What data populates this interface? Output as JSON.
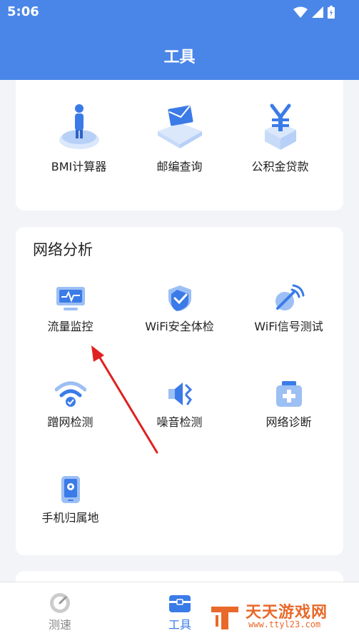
{
  "status_bar": {
    "time": "5:06"
  },
  "app_bar": {
    "title": "工具"
  },
  "top_tools": [
    {
      "label": "BMI计算器",
      "icon": "person-on-scale-icon"
    },
    {
      "label": "邮编查询",
      "icon": "envelope-icon"
    },
    {
      "label": "公积金贷款",
      "icon": "yuan-coin-icon"
    }
  ],
  "network_section": {
    "title": "网络分析",
    "tools": [
      {
        "label": "流量监控",
        "icon": "monitor-icon"
      },
      {
        "label": "WiFi安全体检",
        "icon": "shield-check-icon"
      },
      {
        "label": "WiFi信号测试",
        "icon": "satellite-dish-icon"
      },
      {
        "label": "蹭网检测",
        "icon": "wifi-icon"
      },
      {
        "label": "噪音检测",
        "icon": "speaker-icon"
      },
      {
        "label": "网络诊断",
        "icon": "medical-kit-icon"
      },
      {
        "label": "手机归属地",
        "icon": "phone-location-icon"
      }
    ]
  },
  "bottom_nav": [
    {
      "label": "测速",
      "icon": "speedometer-icon",
      "active": false
    },
    {
      "label": "工具",
      "icon": "toolbox-icon",
      "active": true
    }
  ],
  "watermark": {
    "text": "天天游戏网",
    "url": "www.ttyl23.com"
  },
  "colors": {
    "primary": "#4a86e8",
    "icon_blue": "#3b7be8",
    "inactive": "#888888",
    "annotation_red": "#e02020"
  }
}
